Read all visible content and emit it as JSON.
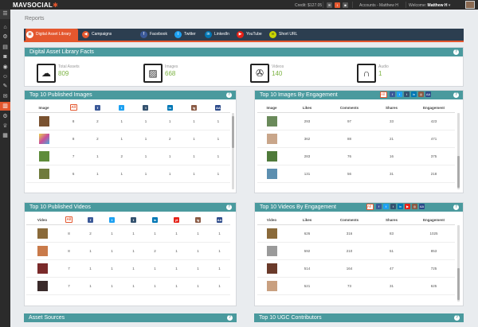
{
  "app": {
    "logo_text": "MAVSOCIAL",
    "credit": "Credit: $127.05",
    "accounts": "Accounts - Matthew H",
    "welcome_prefix": "Welcome:",
    "welcome_name": "Matthew H"
  },
  "page": {
    "breadcrumb": "Reports"
  },
  "tabs": [
    {
      "label": "Digital Asset Library",
      "icon": "library-icon",
      "color": "#e4572e"
    },
    {
      "label": "Campaigns",
      "icon": "megaphone-icon",
      "color": "#e4572e"
    },
    {
      "label": "Facebook",
      "icon": "facebook-icon",
      "color": "#3b5998"
    },
    {
      "label": "Twitter",
      "icon": "twitter-icon",
      "color": "#1da1f2"
    },
    {
      "label": "LinkedIn",
      "icon": "linkedin-icon",
      "color": "#0077b5"
    },
    {
      "label": "YouTube",
      "icon": "youtube-icon",
      "color": "#e62117"
    },
    {
      "label": "Short URL",
      "icon": "link-icon",
      "color": "#c9d400"
    }
  ],
  "facts": {
    "title": "Digital Asset Library Facts",
    "items": [
      {
        "label": "Total Assets",
        "value": "809",
        "icon": "cloud-upload-icon"
      },
      {
        "label": "Images",
        "value": "668",
        "icon": "image-icon"
      },
      {
        "label": "Videos",
        "value": "140",
        "icon": "film-icon"
      },
      {
        "label": "Audio",
        "value": "1",
        "icon": "headphones-icon"
      }
    ]
  },
  "top_images": {
    "title": "Top 10 Published Images",
    "headers": [
      "Image",
      "All",
      "f",
      "t",
      "t",
      "in",
      "ig",
      "AA"
    ],
    "rows": [
      [
        "8",
        "2",
        "1",
        "1",
        "1",
        "1",
        "1"
      ],
      [
        "8",
        "2",
        "1",
        "1",
        "2",
        "1",
        "1"
      ],
      [
        "7",
        "1",
        "2",
        "1",
        "1",
        "1",
        "1"
      ],
      [
        "6",
        "1",
        "1",
        "1",
        "1",
        "1",
        "1"
      ]
    ]
  },
  "top_images_engagement": {
    "title": "Top 10 Images By Engagement",
    "headers": [
      "Image",
      "Likes",
      "Comments",
      "Shares",
      "Engagement"
    ],
    "filter_all": "All",
    "rows": [
      [
        "293",
        "97",
        "33",
        "423"
      ],
      [
        "362",
        "88",
        "21",
        "471"
      ],
      [
        "283",
        "76",
        "16",
        "375"
      ],
      [
        "131",
        "56",
        "31",
        "218"
      ]
    ]
  },
  "top_videos": {
    "title": "Top 10 Published Videos",
    "headers": [
      "Video",
      "All",
      "f",
      "t",
      "t",
      "in",
      "yt",
      "ig",
      "AA"
    ],
    "rows": [
      [
        "8",
        "2",
        "1",
        "1",
        "1",
        "1",
        "1",
        "1"
      ],
      [
        "8",
        "1",
        "1",
        "1",
        "2",
        "1",
        "1",
        "1"
      ],
      [
        "7",
        "1",
        "1",
        "1",
        "1",
        "1",
        "1",
        "1"
      ],
      [
        "7",
        "1",
        "1",
        "1",
        "1",
        "1",
        "1",
        "1"
      ]
    ]
  },
  "top_videos_engagement": {
    "title": "Top 10 Videos By Engagement",
    "headers": [
      "Video",
      "Likes",
      "Comments",
      "Shares",
      "Engagement"
    ],
    "filter_all": "All",
    "rows": [
      [
        "626",
        "316",
        "83",
        "1025"
      ],
      [
        "592",
        "210",
        "51",
        "853"
      ],
      [
        "514",
        "164",
        "47",
        "725"
      ],
      [
        "521",
        "73",
        "31",
        "625"
      ]
    ]
  },
  "bottom": {
    "asset_sources": "Asset Sources",
    "ugc": "Top 10 UGC Contributors"
  },
  "colors": {
    "accent": "#e4572e",
    "teal": "#4a9a9e",
    "nav": "#2c3e50",
    "green_value": "#7cb342"
  }
}
